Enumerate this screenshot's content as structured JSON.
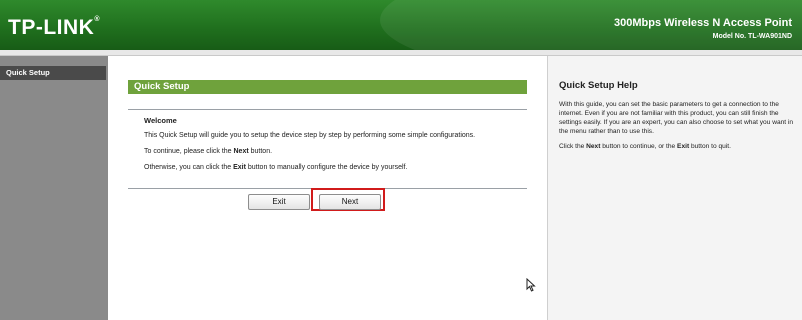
{
  "header": {
    "logo": "TP-LINK",
    "logo_mark": "®",
    "product_title": "300Mbps Wireless N Access Point",
    "model_label": "Model No.",
    "model_number": "TL-WA901ND"
  },
  "sidebar": {
    "items": [
      {
        "label": "Quick Setup",
        "active": true
      }
    ]
  },
  "main": {
    "section_title": "Quick Setup",
    "welcome": "Welcome",
    "para1": "This Quick Setup will guide you to setup the device step by step by performing some simple configurations.",
    "para2_pre": "To continue, please click the ",
    "para2_bold": "Next",
    "para2_post": " button.",
    "para3_pre": "Otherwise, you can click the ",
    "para3_bold": "Exit",
    "para3_post": " button to manually configure the device by yourself.",
    "exit_label": "Exit",
    "next_label": "Next"
  },
  "help": {
    "title": "Quick Setup Help",
    "text": "With this guide, you can set the basic parameters to get a connection to the internet. Even if you are not familiar with this product, you can still finish the settings easily. If you are an expert, you can also choose to set what you want in the menu rather than to use this.",
    "text2_pre": "Click the ",
    "text2_bold1": "Next",
    "text2_mid": " button to continue, or the ",
    "text2_bold2": "Exit",
    "text2_post": " button to quit."
  },
  "colors": {
    "header_green": "#1f6e1d",
    "section_green": "#6fa23c",
    "highlight_red": "#d11b1b"
  }
}
